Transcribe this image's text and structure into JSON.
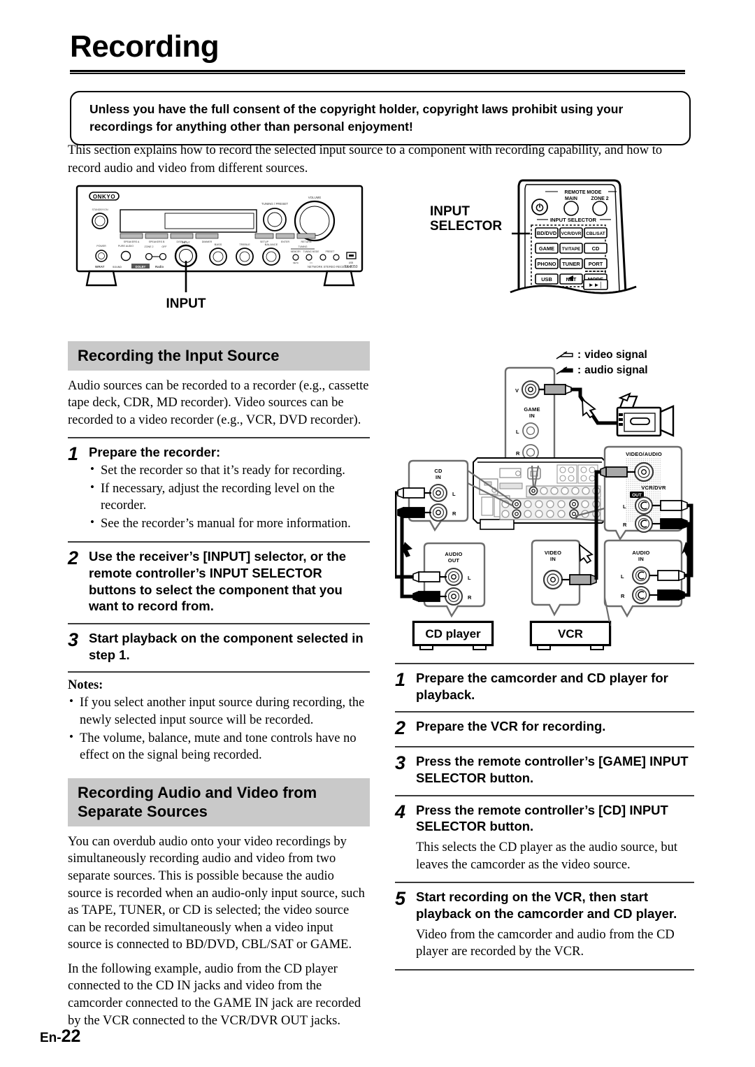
{
  "page": {
    "title": "Recording",
    "footer_prefix": "En-",
    "footer_number": "22"
  },
  "notice": "Unless you have the full consent of the copyright holder, copyright laws prohibit using your recordings for anything other than personal enjoyment!",
  "intro": "This section explains how to record the selected input source to a component with recording capability, and how to record audio and video from different sources.",
  "receiver_illustration": {
    "brand": "ONKYO",
    "callout_label": "INPUT",
    "model_text": "NETWORK STEREO RECEIVER  TX-8050",
    "knob_labels": [
      "VOLUME",
      "TUNING / PRESET"
    ],
    "front_controls": [
      "POWER",
      "PURE AUDIO",
      "ZONE 2",
      "OFF",
      "INPUT",
      "BASS",
      "TREBLE",
      "BALANCE",
      "MEMORY",
      "TUNING MODE",
      "PRESET",
      "USB"
    ]
  },
  "remote_illustration": {
    "callout_line1": "INPUT",
    "callout_line2": "SELECTOR",
    "remote_mode_label": "REMOTE MODE",
    "remote_mode_buttons": [
      "MAIN",
      "ZONE 2"
    ],
    "input_selector_label": "INPUT SELECTOR",
    "buttons": [
      [
        "BD/DVD",
        "VCR/DVR",
        "CBL/SAT"
      ],
      [
        "GAME",
        "TV/TAPE",
        "CD"
      ],
      [
        "PHONO",
        "TUNER",
        "PORT"
      ],
      [
        "USB",
        "NET",
        "MODE"
      ]
    ],
    "skip_button": "►►│"
  },
  "section1": {
    "heading": "Recording the Input Source",
    "intro": "Audio sources can be recorded to a recorder (e.g., cassette tape deck, CDR, MD recorder). Video sources can be recorded to a video recorder (e.g., VCR, DVD recorder).",
    "steps": [
      {
        "num": "1",
        "title": "Prepare the recorder:",
        "bullets": [
          "Set the recorder so that it’s ready for recording.",
          "If necessary, adjust the recording level on the recorder.",
          "See the recorder’s manual for more information."
        ]
      },
      {
        "num": "2",
        "title": "Use the receiver’s [INPUT] selector, or the remote controller’s INPUT SELECTOR buttons to select the component that you want to record from.",
        "bullets": []
      },
      {
        "num": "3",
        "title": "Start playback on the component selected in step 1.",
        "bullets": []
      }
    ],
    "notes_label": "Notes:",
    "notes": [
      "If you select another input source during recording, the newly selected input source will be recorded.",
      "The volume, balance, mute and tone controls have no effect on the signal being recorded."
    ]
  },
  "section2": {
    "heading_line1": "Recording Audio and Video from",
    "heading_line2": "Separate Sources",
    "paragraphs": [
      "You can overdub audio onto your video recordings by simultaneously recording audio and video from two separate sources. This is possible because the audio source is recorded when an audio-only input source, such as TAPE, TUNER, or CD is selected; the video source can be recorded simultaneously when a video input source is connected to BD/DVD, CBL/SAT or GAME.",
      "In the following example, audio from the CD player connected to the CD IN jacks and video from the camcorder connected to the GAME IN jack are recorded by the VCR connected to the VCR/DVR OUT jacks."
    ]
  },
  "diagram": {
    "legend": [
      {
        "label": "video signal",
        "style": "outline-arrow"
      },
      {
        "label": "audio signal",
        "style": "solid-arrow"
      }
    ],
    "game_panel": {
      "title": "GAME\nIN",
      "title_line1": "GAME",
      "title_line2": "IN",
      "jacks": [
        "V",
        "L",
        "R"
      ]
    },
    "cd_panel": {
      "title_line1": "CD",
      "title_line2": "IN",
      "jacks": [
        "L",
        "R"
      ]
    },
    "cd_out_panel": {
      "title_line1": "AUDIO",
      "title_line2": "OUT",
      "jacks": [
        "L",
        "R"
      ]
    },
    "vcr_video_panel": {
      "title_line1": "VIDEO",
      "title_line2": "IN",
      "jacks": []
    },
    "vcr_audio_panel": {
      "title_line1": "AUDIO",
      "title_line2": "IN",
      "jacks": [
        "L",
        "R"
      ]
    },
    "receiver_out_panel": {
      "title": "VIDEO/AUDIO",
      "sub_line1": "VCR/DVR",
      "sub_badge": "OUT",
      "jacks": [
        "L",
        "R"
      ]
    },
    "device_labels": {
      "cd_player": "CD player",
      "vcr": "VCR",
      "camcorder": "camcorder"
    }
  },
  "section2_steps": [
    {
      "num": "1",
      "title": "Prepare the camcorder and CD player for playback.",
      "note": ""
    },
    {
      "num": "2",
      "title": "Prepare the VCR for recording.",
      "note": ""
    },
    {
      "num": "3",
      "title": "Press the remote controller’s [GAME] INPUT SELECTOR button.",
      "note": ""
    },
    {
      "num": "4",
      "title": "Press the remote controller’s [CD] INPUT SELECTOR button.",
      "note": "This selects the CD player as the audio source, but leaves the camcorder as the video source."
    },
    {
      "num": "5",
      "title": "Start recording on the VCR, then start playback on the camcorder and CD player.",
      "note": "Video from the camcorder and audio from the CD player are recorded by the VCR."
    }
  ],
  "colors": {
    "section_band": "#c9c9c9",
    "rule": "#3a3a3a",
    "ink": "#000000"
  }
}
